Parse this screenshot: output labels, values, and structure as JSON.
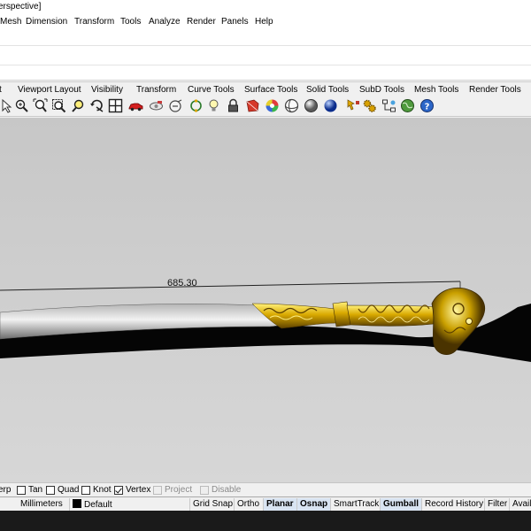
{
  "window": {
    "title": "erspective]"
  },
  "menu": [
    "Mesh",
    "Dimension",
    "Transform",
    "Tools",
    "Analyze",
    "Render",
    "Panels",
    "Help"
  ],
  "tabs": [
    "t",
    "Viewport Layout",
    "Visibility",
    "Transform",
    "Curve Tools",
    "Surface Tools",
    "Solid Tools",
    "SubD Tools",
    "Mesh Tools",
    "Render Tools"
  ],
  "toolbar_icons": [
    "cursor-icon",
    "zoom-window-icon",
    "zoom-extents-icon",
    "zoom-selected-icon",
    "zoom-dynamic-icon",
    "rotate-view-icon",
    "viewport-grid-icon",
    "car-icon",
    "named-view-icon",
    "camera-icon",
    "osnap-icon",
    "light-bulb-icon",
    "brush-icon",
    "lock-icon",
    "shaded-icon",
    "color-wheel-icon",
    "rendered-sphere-icon",
    "ghosted-sphere-icon",
    "blue-sphere-icon",
    "pointer-flag-icon",
    "gear-icon",
    "diagram-icon",
    "globe-icon",
    "help-icon"
  ],
  "viewport": {
    "dimension": "685.30"
  },
  "osnap": [
    {
      "label": "erp",
      "checked": false,
      "enabled": true
    },
    {
      "label": "Tan",
      "checked": false,
      "enabled": true
    },
    {
      "label": "Quad",
      "checked": false,
      "enabled": true
    },
    {
      "label": "Knot",
      "checked": false,
      "enabled": true
    },
    {
      "label": "Vertex",
      "checked": true,
      "enabled": true
    },
    {
      "label": "Project",
      "checked": false,
      "enabled": false
    },
    {
      "label": "Disable",
      "checked": false,
      "enabled": false
    }
  ],
  "status": {
    "units": "Millimeters",
    "layer": "Default",
    "layer_color": "#000000",
    "toggles": [
      {
        "label": "Grid Snap",
        "active": false
      },
      {
        "label": "Ortho",
        "active": false
      },
      {
        "label": "Planar",
        "active": true
      },
      {
        "label": "Osnap",
        "active": true
      },
      {
        "label": "SmartTrack",
        "active": false
      },
      {
        "label": "Gumball",
        "active": true
      },
      {
        "label": "Record History",
        "active": false
      },
      {
        "label": "Filter",
        "active": false
      },
      {
        "label": "Avail",
        "active": false
      }
    ]
  }
}
